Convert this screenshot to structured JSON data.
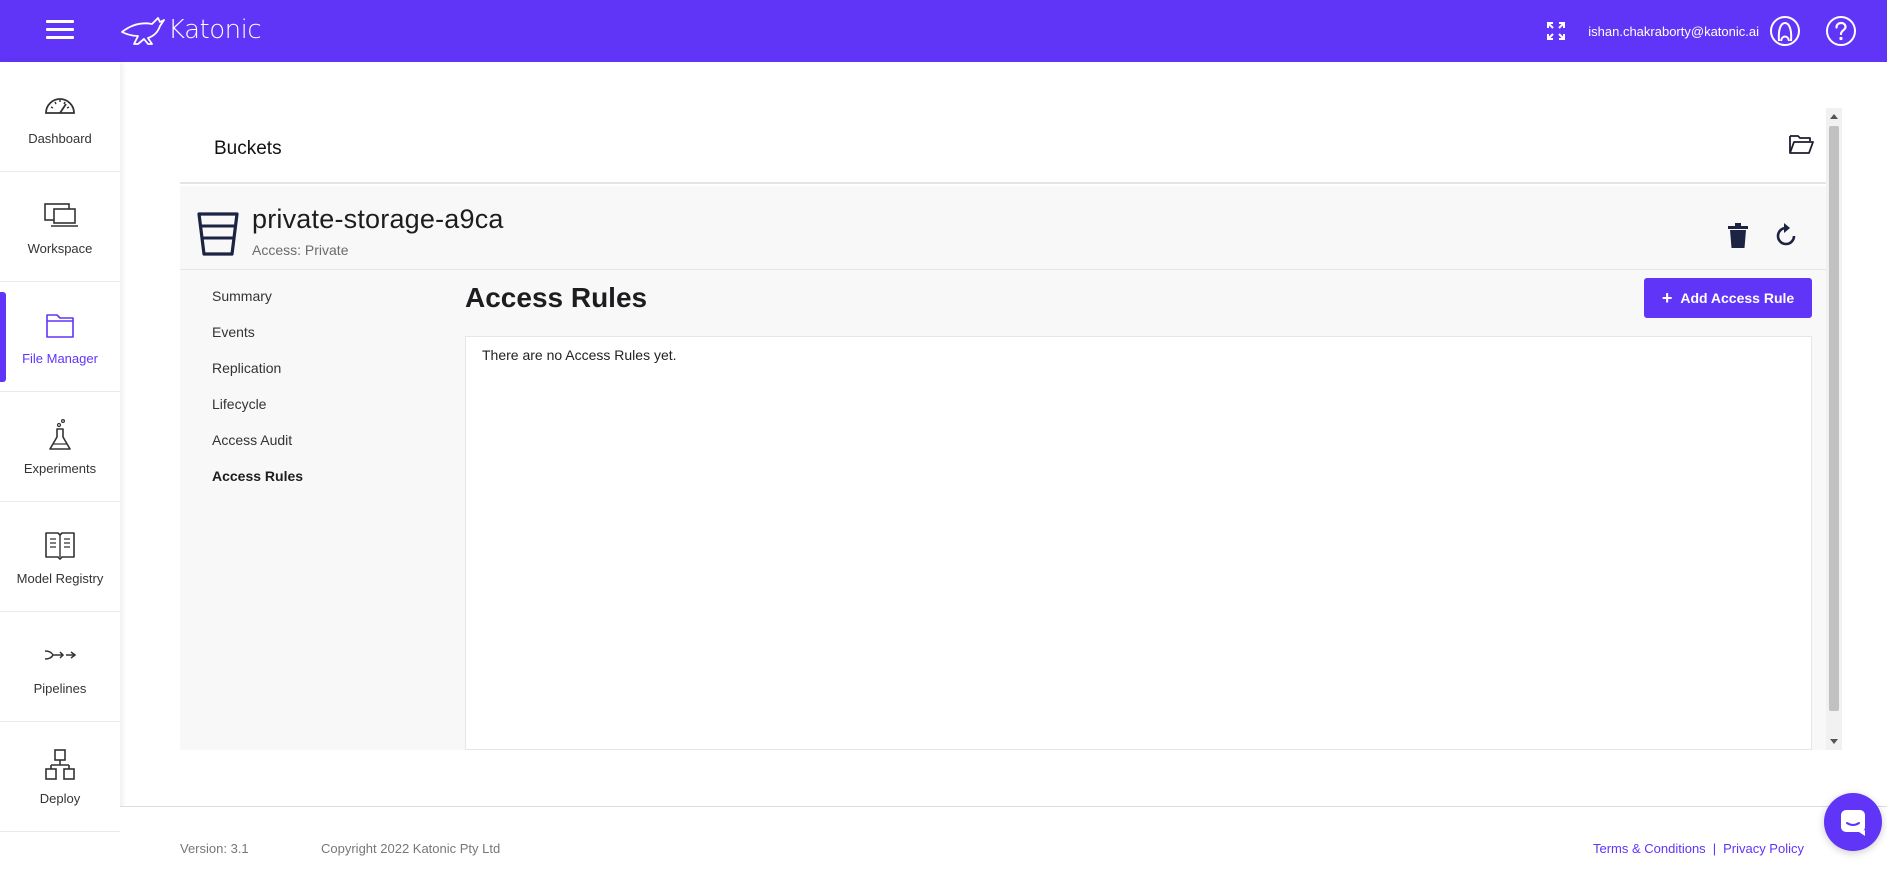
{
  "header": {
    "brand": "Katonic",
    "user_email": "ishan.chakraborty@katonic.ai"
  },
  "sidebar": {
    "items": [
      {
        "label": "Dashboard",
        "icon": "gauge-icon"
      },
      {
        "label": "Workspace",
        "icon": "monitor-icon"
      },
      {
        "label": "File Manager",
        "icon": "folder-icon",
        "active": true
      },
      {
        "label": "Experiments",
        "icon": "flask-icon"
      },
      {
        "label": "Model Registry",
        "icon": "book-icon"
      },
      {
        "label": "Pipelines",
        "icon": "pipeline-icon"
      },
      {
        "label": "Deploy",
        "icon": "network-icon"
      }
    ]
  },
  "main": {
    "title": "Buckets",
    "bucket": {
      "name": "private-storage-a9ca",
      "access": "Access: Private"
    },
    "menu": [
      {
        "label": "Summary"
      },
      {
        "label": "Events"
      },
      {
        "label": "Replication"
      },
      {
        "label": "Lifecycle"
      },
      {
        "label": "Access Audit"
      },
      {
        "label": "Access Rules",
        "active": true
      }
    ],
    "section_title": "Access Rules",
    "add_button_label": "Add Access Rule",
    "empty_message": "There are no Access Rules yet."
  },
  "footer": {
    "version": "Version: 3.1",
    "copyright": "Copyright 2022 Katonic Pty Ltd",
    "terms": "Terms & Conditions",
    "separator": "|",
    "privacy": "Privacy Policy"
  },
  "colors": {
    "accent": "#6035f7"
  }
}
